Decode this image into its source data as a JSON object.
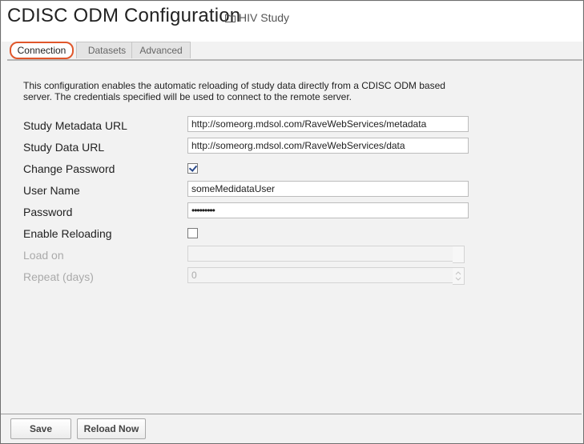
{
  "header": {
    "title": "CDISC ODM Configuration",
    "folder_label": "HIV Study"
  },
  "tabs": [
    {
      "label": "Connection",
      "active": true
    },
    {
      "label": "Datasets",
      "active": false
    },
    {
      "label": "Advanced",
      "active": false
    }
  ],
  "connection": {
    "description": "This configuration enables the automatic reloading of study data directly from a CDISC ODM based server. The credentials specified will be used to connect to the remote server.",
    "metadata_url": {
      "label": "Study Metadata URL",
      "value": "http://someorg.mdsol.com/RaveWebServices/metadata"
    },
    "data_url": {
      "label": "Study Data URL",
      "value": "http://someorg.mdsol.com/RaveWebServices/data"
    },
    "change_password": {
      "label": "Change Password",
      "checked": true
    },
    "user_name": {
      "label": "User Name",
      "value": "someMedidataUser"
    },
    "password": {
      "label": "Password",
      "value": "•••••••••"
    },
    "enable_reloading": {
      "label": "Enable Reloading",
      "checked": false
    },
    "load_on": {
      "label": "Load on",
      "value": ""
    },
    "repeat_days": {
      "label": "Repeat (days)",
      "value": "0"
    }
  },
  "footer": {
    "save_label": "Save",
    "reload_label": "Reload Now"
  },
  "colors": {
    "active_tab_outline": "#e0572b",
    "checkbox_check": "#2b4a8a"
  },
  "icons": {
    "folder": "folder-icon"
  }
}
